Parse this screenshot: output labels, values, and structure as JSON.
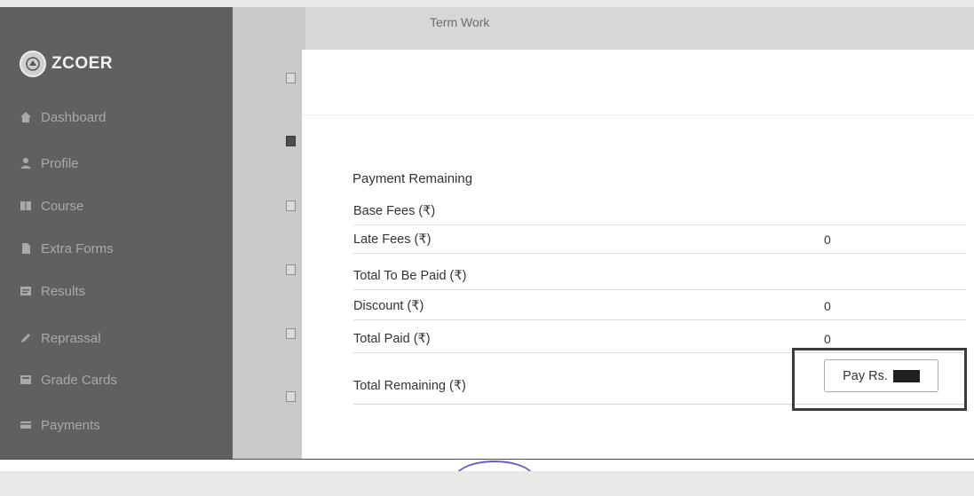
{
  "brand": {
    "name": "ZCOER",
    "logo_icon": "college-emblem-icon"
  },
  "header": {
    "title": "Term Work"
  },
  "sidebar": {
    "items": [
      {
        "label": "Dashboard",
        "icon": "home-icon"
      },
      {
        "label": "Profile",
        "icon": "user-icon"
      },
      {
        "label": "Course",
        "icon": "book-icon"
      },
      {
        "label": "Extra Forms",
        "icon": "document-icon"
      },
      {
        "label": "Results",
        "icon": "results-icon"
      },
      {
        "label": "Reprassal",
        "icon": "pencil-icon"
      },
      {
        "label": "Grade Cards",
        "icon": "card-icon"
      },
      {
        "label": "Payments",
        "icon": "payment-icon"
      }
    ]
  },
  "payment": {
    "title": "Payment Remaining",
    "rows": [
      {
        "label": "Base Fees (₹)",
        "value": ""
      },
      {
        "label": "Late Fees (₹)",
        "value": "0"
      },
      {
        "label": "Total To Be Paid (₹)",
        "value": ""
      },
      {
        "label": "Discount (₹)",
        "value": "0"
      },
      {
        "label": "Total Paid (₹)",
        "value": "0"
      },
      {
        "label": "Total Remaining (₹)",
        "value": ""
      }
    ],
    "pay_button_label": "Pay Rs."
  },
  "colors": {
    "sidebar_bg": "#5f605f",
    "sidebar_text": "#a9a9a8",
    "highlight_border": "#3a3a3a"
  }
}
